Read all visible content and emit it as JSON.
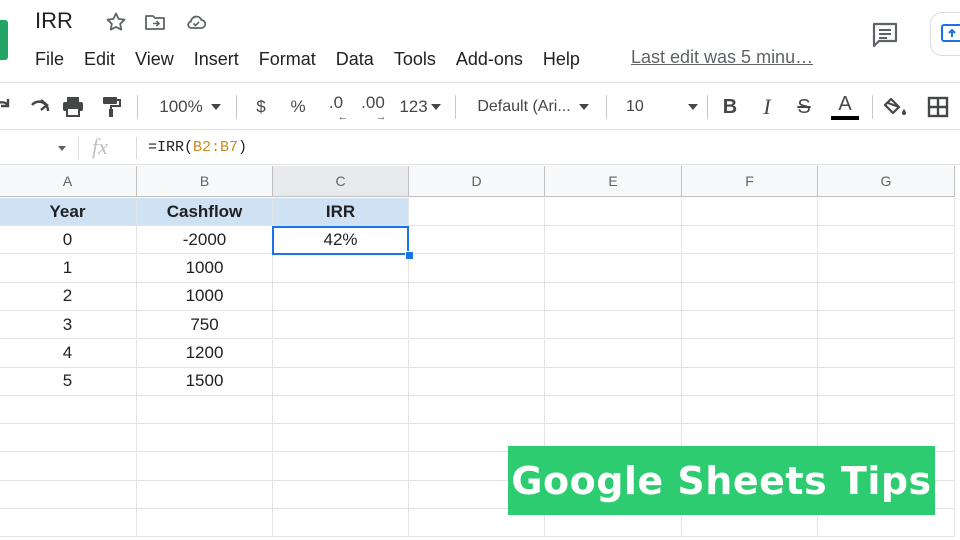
{
  "app": {
    "doc_title": "IRR",
    "last_edit": "Last edit was 5 minu…",
    "menu": [
      "File",
      "Edit",
      "View",
      "Insert",
      "Format",
      "Data",
      "Tools",
      "Add-ons",
      "Help"
    ]
  },
  "toolbar": {
    "zoom": "100%",
    "currency": "$",
    "percent": "%",
    "decrease_decimals": ".0",
    "increase_decimals": ".00",
    "more_formats": "123",
    "font": "Default (Ari...",
    "font_size": "10",
    "bold": "B",
    "italic": "I",
    "strikethrough": "S",
    "text_color_letter": "A"
  },
  "formula_bar": {
    "fx": "fx",
    "prefix": "=IRR(",
    "range": "B2:B7",
    "suffix": ")"
  },
  "sheet": {
    "columns": [
      "A",
      "B",
      "C",
      "D",
      "E",
      "F",
      "G"
    ],
    "active_column": "C",
    "headers": [
      "Year",
      "Cashflow",
      "IRR"
    ],
    "rows": [
      [
        "0",
        "-2000",
        "42%"
      ],
      [
        "1",
        "1000",
        ""
      ],
      [
        "2",
        "1000",
        ""
      ],
      [
        "3",
        "750",
        ""
      ],
      [
        "4",
        "1200",
        ""
      ],
      [
        "5",
        "1500",
        ""
      ]
    ],
    "selected_cell": "C2"
  },
  "banner": {
    "text": "Google Sheets Tips"
  },
  "colors": {
    "header_fill": "#cfe2f3",
    "selection": "#1a73e8",
    "banner": "#2ecc71",
    "range_highlight": "#c98a21"
  }
}
